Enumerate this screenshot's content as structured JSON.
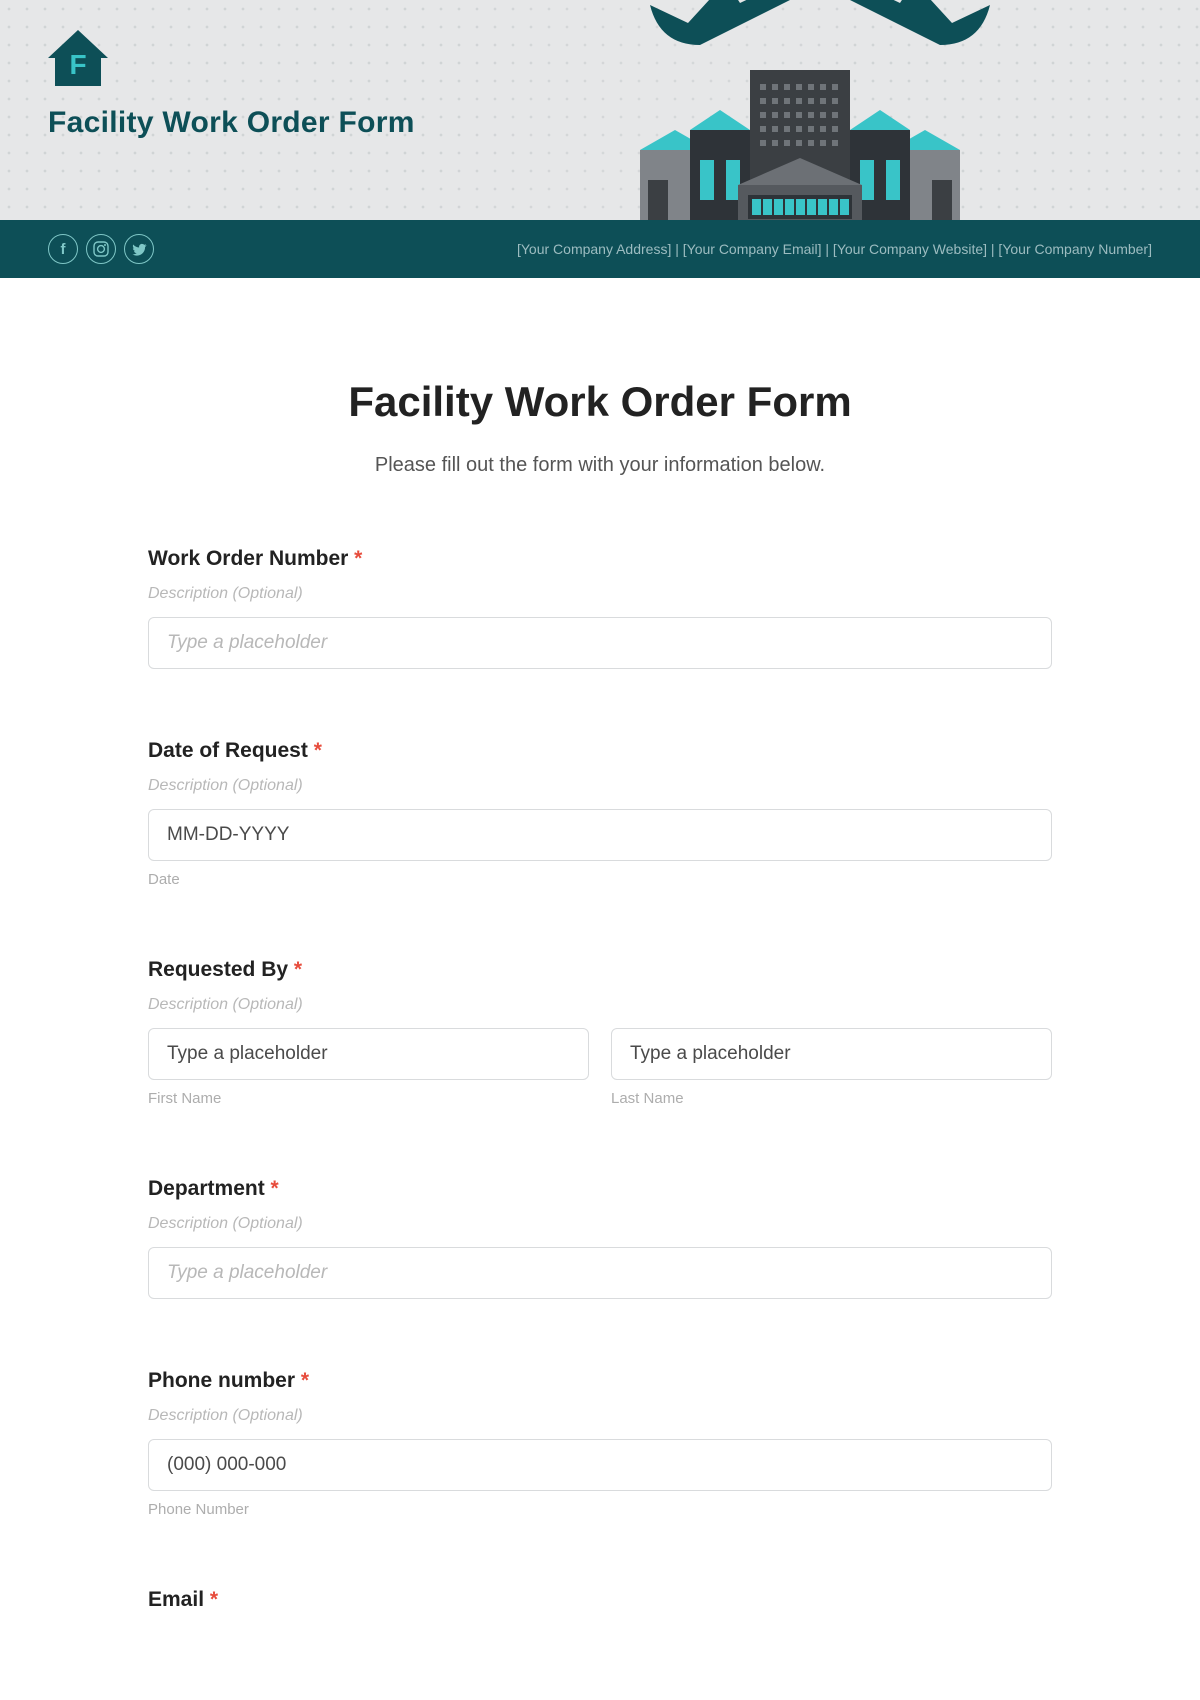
{
  "brand": {
    "title": "Facility Work Order Form"
  },
  "company_line": "[Your Company Address]  |  [Your Company Email]  |  [Your Company Website]  |  [Your Company Number]",
  "form": {
    "title": "Facility Work Order Form",
    "subtitle": "Please fill out the form with your information below.",
    "desc_placeholder": "Description (Optional)",
    "text_placeholder": "Type a placeholder",
    "fields": {
      "work_order_number": {
        "label": "Work Order Number"
      },
      "date_of_request": {
        "label": "Date of Request",
        "placeholder": "MM-DD-YYYY",
        "sublabel": "Date"
      },
      "requested_by": {
        "label": "Requested By",
        "first_sub": "First Name",
        "last_sub": "Last Name"
      },
      "department": {
        "label": "Department"
      },
      "phone": {
        "label": "Phone number",
        "placeholder": "(000) 000-000",
        "sublabel": "Phone Number"
      },
      "email": {
        "label": "Email"
      }
    },
    "required_mark": "*"
  }
}
